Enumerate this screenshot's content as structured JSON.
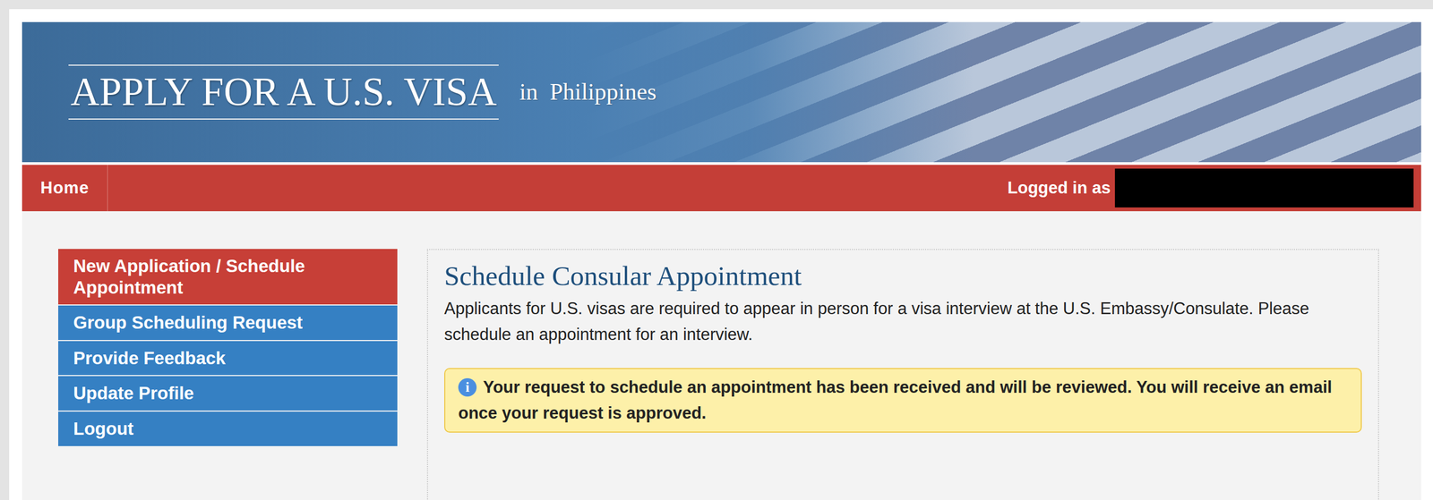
{
  "header": {
    "title": "APPLY FOR A U.S. VISA",
    "location": "in  Philippines"
  },
  "topbar": {
    "home": "Home",
    "user_label": "Logged in as"
  },
  "sidebar": {
    "items": [
      {
        "label": "New Application / Schedule Appointment",
        "selected": true
      },
      {
        "label": "Group Scheduling Request",
        "selected": false
      },
      {
        "label": "Provide Feedback",
        "selected": false
      },
      {
        "label": "Update Profile",
        "selected": false
      },
      {
        "label": "Logout",
        "selected": false
      }
    ]
  },
  "main": {
    "title": "Schedule Consular Appointment",
    "intro": "Applicants for U.S. visas are required to appear in person for a visa interview at the U.S. Embassy/Consulate. Please schedule an appointment for an interview.",
    "alert": {
      "icon": "i",
      "text": "Your request to schedule an appointment has been received and will be reviewed. You will receive an email once your request is approved."
    }
  }
}
